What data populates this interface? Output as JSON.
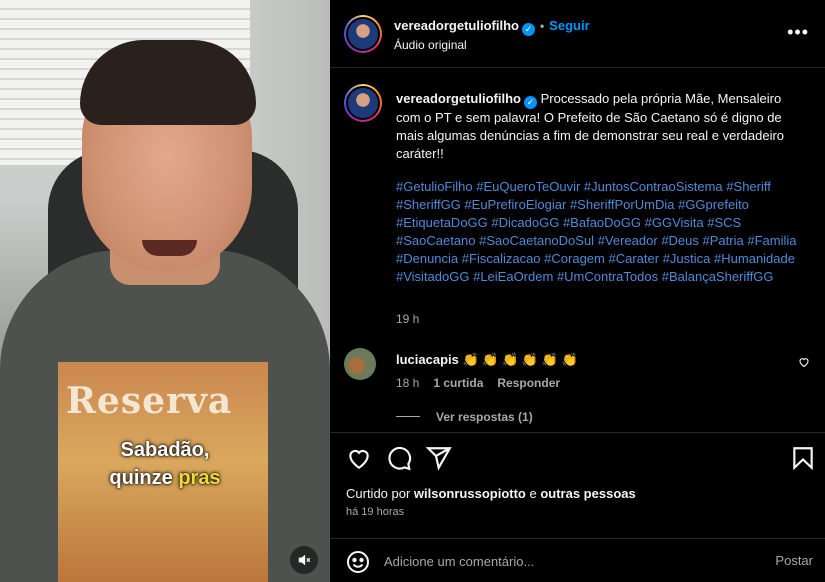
{
  "video": {
    "caption_line1": "Sabadão,",
    "caption_line2_a": "quinze ",
    "caption_line2_b": "pras",
    "shirt_print": "Reserva"
  },
  "header": {
    "username": "vereadorgetuliofilho",
    "verified_mark": "✓",
    "separator": "•",
    "follow_label": "Seguir",
    "subtitle": "Áudio original",
    "more_label": "•••"
  },
  "post": {
    "username": "vereadorgetuliofilho",
    "verified_mark": "✓",
    "text": "Processado pela própria Mãe, Mensaleiro com o PT e sem palavra! O Prefeito de São Caetano só é digno de mais algumas denúncias a fim de demonstrar seu real e verdadeiro caráter!!",
    "hashtags": [
      "#GetulioFilho",
      "#EuQueroTeOuvir",
      "#JuntosContraoSistema",
      "#Sheriff",
      "#SheriffGG",
      "#EuPrefiroElogiar",
      "#SheriffPorUmDia",
      "#GGprefeito",
      "#EtiquetaDoGG",
      "#DicadoGG",
      "#BafaoDoGG",
      "#GGVisita",
      "#SCS",
      "#SaoCaetano",
      "#SaoCaetanoDoSul",
      "#Vereador",
      "#Deus",
      "#Patria",
      "#Familia",
      "#Denuncia",
      "#Fiscalizacao",
      "#Coragem",
      "#Carater",
      "#Justica",
      "#Humanidade",
      "#VisitadoGG",
      "#LeiEaOrdem",
      "#UmContraTodos",
      "#BalançaSheriffGG"
    ],
    "time": "19 h"
  },
  "comment": {
    "username": "luciacapis",
    "text": "👏 👏 👏 👏 👏 👏",
    "time": "18 h",
    "likes": "1 curtida",
    "reply_label": "Responder",
    "view_replies": "Ver respostas (1)"
  },
  "likes": {
    "prefix": "Curtido por ",
    "user": "wilsonrussopiotto",
    "middle": " e ",
    "others": "outras pessoas"
  },
  "time_ago": "há 19 horas",
  "comment_box": {
    "placeholder": "Adicione um comentário...",
    "post_label": "Postar"
  },
  "icons": [
    "mute-icon",
    "heart-icon",
    "comment-icon",
    "share-icon",
    "bookmark-icon",
    "emoji-icon",
    "more-icon",
    "verified-icon"
  ]
}
